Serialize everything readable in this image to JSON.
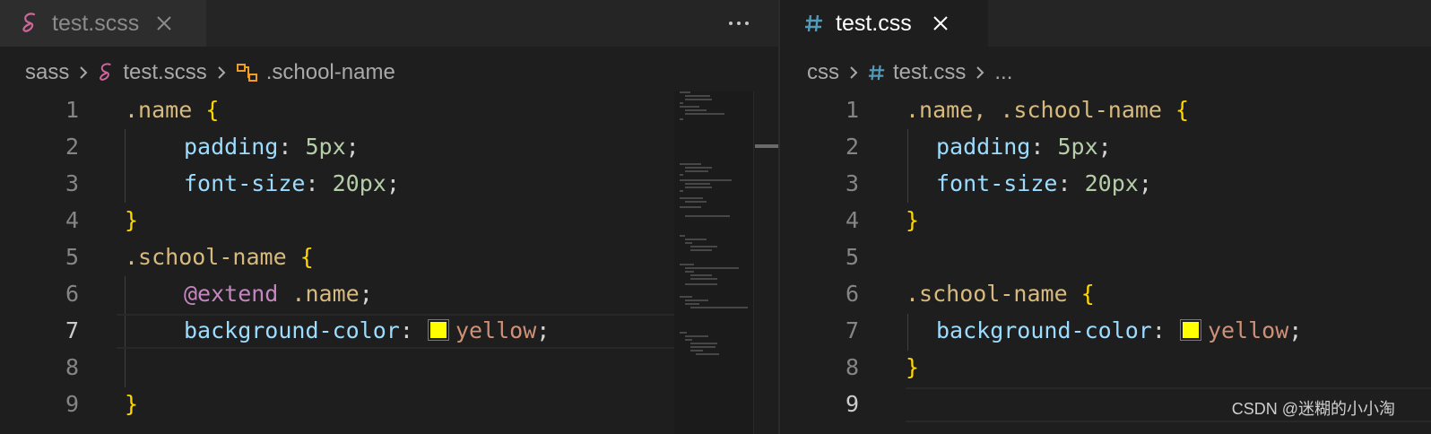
{
  "left": {
    "tab": {
      "label": "test.scss",
      "icon": "sass-icon",
      "close": "close-icon"
    },
    "more_actions": "more-actions-icon",
    "breadcrumb": {
      "folder": "sass",
      "file": "test.scss",
      "symbol": ".school-name"
    },
    "line_numbers": [
      "1",
      "2",
      "3",
      "4",
      "5",
      "6",
      "7",
      "8",
      "9"
    ],
    "code": {
      "l1": {
        "sel": ".name",
        "brace": "{"
      },
      "l2": {
        "prop": "padding",
        "colon": ":",
        "num": "5px",
        "semi": ";"
      },
      "l3": {
        "prop": "font-size",
        "colon": ":",
        "num": "20px",
        "semi": ";"
      },
      "l4": {
        "brace": "}"
      },
      "l5": {
        "sel": ".school-name",
        "brace": "{"
      },
      "l6": {
        "kw": "@extend",
        "sel": ".name",
        "semi": ";"
      },
      "l7": {
        "prop": "background-color",
        "colon": ":",
        "val": "yellow",
        "semi": ";"
      },
      "l9": {
        "brace": "}"
      }
    },
    "active_line": "7"
  },
  "right": {
    "tab": {
      "label": "test.css",
      "icon": "hash-icon",
      "close": "close-icon"
    },
    "breadcrumb": {
      "folder": "css",
      "file": "test.css",
      "symbol": "..."
    },
    "line_numbers": [
      "1",
      "2",
      "3",
      "4",
      "5",
      "6",
      "7",
      "8",
      "9"
    ],
    "code": {
      "l1": {
        "sel": ".name, .school-name",
        "brace": "{"
      },
      "l2": {
        "prop": "padding",
        "colon": ":",
        "num": "5px",
        "semi": ";"
      },
      "l3": {
        "prop": "font-size",
        "colon": ":",
        "num": "20px",
        "semi": ";"
      },
      "l4": {
        "brace": "}"
      },
      "l6": {
        "sel": ".school-name",
        "brace": "{"
      },
      "l7": {
        "prop": "background-color",
        "colon": ":",
        "val": "yellow",
        "semi": ";"
      },
      "l8": {
        "brace": "}"
      }
    },
    "active_line": "9"
  },
  "watermark": "CSDN @迷糊的小小淘",
  "colors": {
    "background": "#1e1e1e",
    "selector": "#d7ba7d",
    "property": "#9cdcfe",
    "number": "#b5cea8",
    "value": "#ce9178",
    "keyword": "#c586c0",
    "brace": "#ffd700",
    "swatch_yellow": "#ffff00",
    "sass_icon": "#cd6799",
    "css_icon": "#519aba"
  }
}
